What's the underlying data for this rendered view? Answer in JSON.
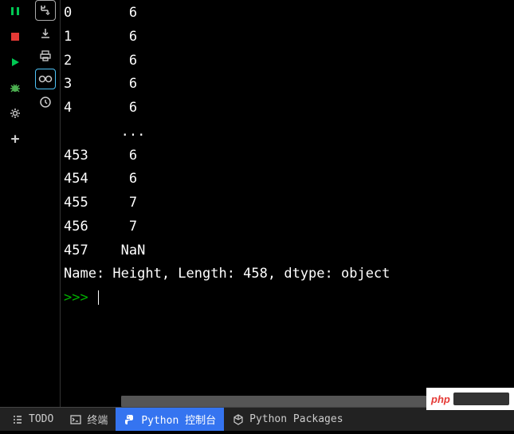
{
  "console": {
    "lines": [
      "0       6",
      "1       6",
      "2       6",
      "3       6",
      "4       6",
      "       ...",
      "453     6",
      "454     6",
      "455     7",
      "456     7",
      "457    NaN"
    ],
    "summary": "Name: Height, Length: 458, dtype: object",
    "prompt": ">>> "
  },
  "tabs": {
    "todo": "TODO",
    "terminal": "终端",
    "python_console": "Python 控制台",
    "python_packages": "Python Packages"
  },
  "chart_data": {
    "type": "table",
    "title": "Height",
    "length": 458,
    "dtype": "object",
    "head": [
      {
        "index": 0,
        "value": "6"
      },
      {
        "index": 1,
        "value": "6"
      },
      {
        "index": 2,
        "value": "6"
      },
      {
        "index": 3,
        "value": "6"
      },
      {
        "index": 4,
        "value": "6"
      }
    ],
    "tail": [
      {
        "index": 453,
        "value": "6"
      },
      {
        "index": 454,
        "value": "6"
      },
      {
        "index": 455,
        "value": "7"
      },
      {
        "index": 456,
        "value": "7"
      },
      {
        "index": 457,
        "value": "NaN"
      }
    ]
  },
  "watermark": {
    "brand": "php"
  }
}
